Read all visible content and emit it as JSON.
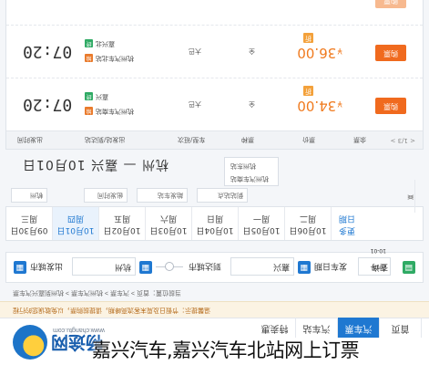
{
  "site": {
    "brand": "畅途网",
    "domain": "www.changtu.com"
  },
  "nav": [
    {
      "label": "首页"
    },
    {
      "label": "汽车票"
    },
    {
      "label": "汽车站"
    },
    {
      "label": "特卖惠"
    }
  ],
  "notice": "温馨提示：节假日及周末客流高峰期，请提前购票，以免耽误您的行程",
  "breadcrumb": "当前位置：首页 > 汽车票 > 杭州汽车票 > 杭州到嘉兴汽车票",
  "search": {
    "from_label": "出发城市",
    "from_value": "杭州",
    "to_label": "到达城市",
    "to_value": "嘉兴",
    "date_label": "发车日期",
    "date_value": "2015-10-01",
    "button": "查询"
  },
  "dates": [
    {
      "date": "09月30日",
      "weekday": "周三"
    },
    {
      "date": "10月01日",
      "weekday": "周四",
      "active": true
    },
    {
      "date": "10月02日",
      "weekday": "周五"
    },
    {
      "date": "10月03日",
      "weekday": "周六"
    },
    {
      "date": "10月04日",
      "weekday": "周日"
    },
    {
      "date": "10月05日",
      "weekday": "周一"
    },
    {
      "date": "10月06日",
      "weekday": "周二"
    }
  ],
  "date_nav": {
    "prev": "<",
    "next": ">",
    "more_line1": "更多",
    "more_line2": "日期"
  },
  "filters": {
    "city": "杭州",
    "depart_time": "出发时间",
    "depart_station": "始发车站",
    "arrive_station": "到站站点",
    "popup_items": [
      "杭州汽车南站",
      "杭州东站"
    ]
  },
  "route_title": "杭州 — 嘉兴   10月01日",
  "table": {
    "headers": {
      "time": "出发时间",
      "stations": "出发站/到达站",
      "vehicle": "车型/班次",
      "type": "票种",
      "price": "票价",
      "remain": "余票",
      "pager": "< 1/3 >"
    },
    "rows": [
      {
        "time": "07:20",
        "from": "杭州汽车南站",
        "to": "嘉兴",
        "vehicle": "大巴",
        "type": "全",
        "price": "34.00",
        "currency": "¥",
        "discount": "折",
        "button": "购票",
        "tag_start": "始",
        "tag_end": "终"
      },
      {
        "time": "07:20",
        "from": "杭州汽车北站",
        "to": "嘉兴北",
        "vehicle": "大巴",
        "type": "全",
        "price": "36.00",
        "currency": "¥",
        "discount": "折",
        "button": "购票",
        "tag_start": "始",
        "tag_end": "终"
      },
      {
        "button": "购票"
      }
    ]
  },
  "caption": "嘉兴汽车,嘉兴汽车北站网上订票"
}
